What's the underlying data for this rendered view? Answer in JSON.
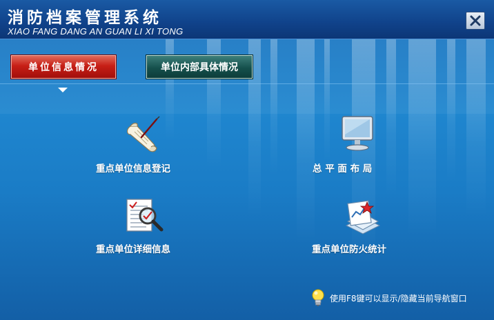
{
  "window": {
    "title_cn": "消防档案管理系统",
    "title_en": "XIAO FANG DANG AN GUAN LI XI TONG",
    "close_icon": "close-icon"
  },
  "tabs": [
    {
      "label": "单位信息情况",
      "active": true
    },
    {
      "label": "单位内部具体情况",
      "active": false
    }
  ],
  "tiles": [
    {
      "label": "重点单位信息登记",
      "icon": "scroll-quill-icon"
    },
    {
      "label": "总 平 面 布 局",
      "icon": "monitor-icon"
    },
    {
      "label": "重点单位详细信息",
      "icon": "document-magnifier-icon"
    },
    {
      "label": "重点单位防火统计",
      "icon": "chart-document-icon"
    }
  ],
  "hint": {
    "icon": "lightbulb-icon",
    "text": "使用F8键可以显示/隐藏当前导航窗口"
  },
  "colors": {
    "background": "#1a7cc6",
    "titlebar": "#10428a",
    "tab_active": "#c71f16",
    "tab_inactive": "#15504c",
    "text": "#ffffff"
  }
}
